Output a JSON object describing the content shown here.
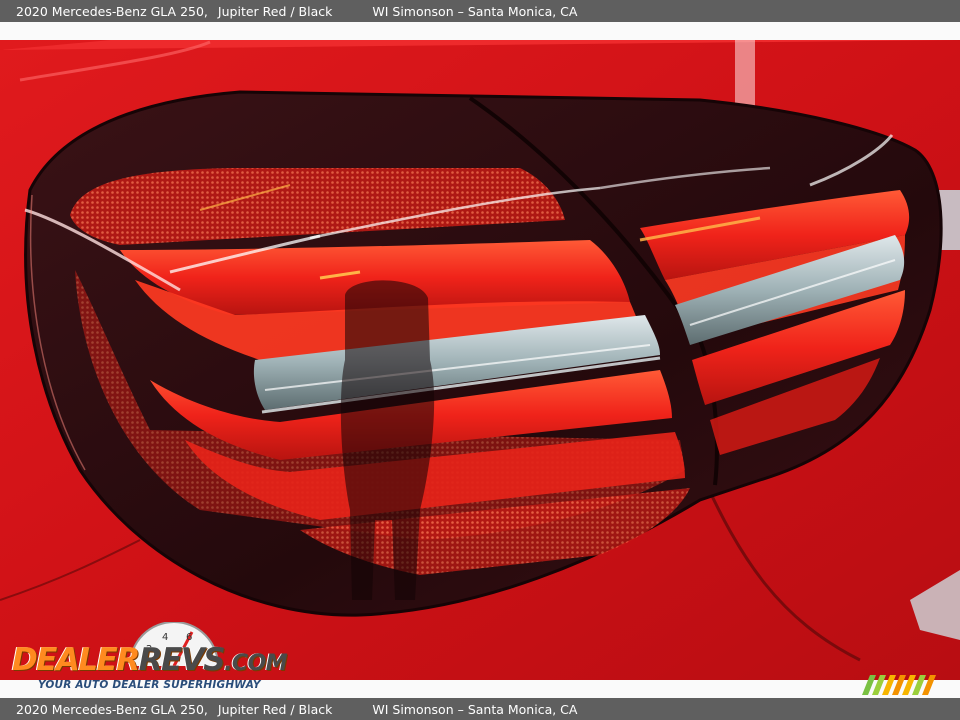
{
  "caption": {
    "vehicle": "2020 Mercedes-Benz GLA 250,",
    "color": "Jupiter Red / Black",
    "dealer": "WI Simonson – Santa Monica, CA"
  },
  "watermark": {
    "logo_part1": "DEALER",
    "logo_part2": "REVS",
    "logo_part3": ".COM",
    "tagline": "YOUR AUTO DEALER SUPERHIGHWAY"
  },
  "colors": {
    "paint": "#d8141a",
    "lens_smoke": "#2a0d10",
    "led_red": "#ff3a22",
    "caption_bar": "#5f5f5f",
    "logo_orange": "#ff8a1f"
  }
}
